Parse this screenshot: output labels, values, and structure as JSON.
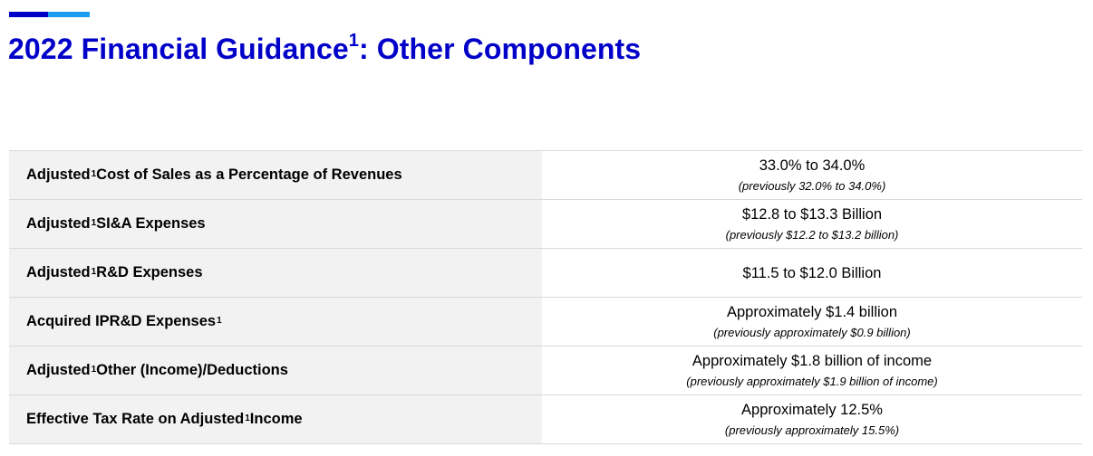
{
  "header": {
    "title_prefix": "2022 Financial Guidance",
    "title_sup": "1",
    "title_suffix": ": Other Components",
    "accent_colors": [
      "#0000c9",
      "#1a9cf0"
    ]
  },
  "guidance": {
    "rows": [
      {
        "label_pre": "Adjusted",
        "label_sup": "1",
        "label_post": " Cost of Sales as a Percentage of Revenues",
        "value": "33.0% to 34.0%",
        "previous": "(previously 32.0% to 34.0%)"
      },
      {
        "label_pre": "Adjusted",
        "label_sup": "1",
        "label_post": " SI&A Expenses",
        "value": "$12.8 to $13.3 Billion",
        "previous": "(previously $12.2 to $13.2 billion)"
      },
      {
        "label_pre": "Adjusted",
        "label_sup": "1",
        "label_post": " R&D Expenses",
        "value": "$11.5 to $12.0 Billion",
        "previous": ""
      },
      {
        "label_pre": "Acquired IPR&D Expenses",
        "label_sup": "1",
        "label_post": "",
        "value": "Approximately $1.4 billion",
        "previous": "(previously approximately $0.9 billion)"
      },
      {
        "label_pre": "Adjusted",
        "label_sup": "1",
        "label_post": " Other (Income)/Deductions",
        "value": "Approximately $1.8 billion of income",
        "previous": "(previously approximately $1.9 billion of income)"
      },
      {
        "label_pre": "Effective Tax Rate on Adjusted",
        "label_sup": "1",
        "label_post": " Income",
        "value": "Approximately 12.5%",
        "previous": "(previously approximately 15.5%)"
      }
    ]
  }
}
